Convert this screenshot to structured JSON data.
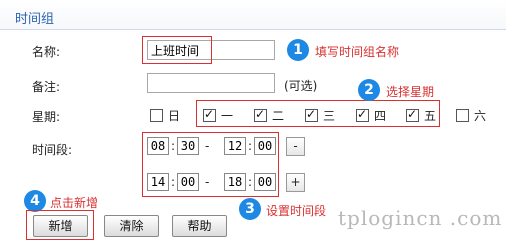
{
  "section_title": "时间组",
  "fields": {
    "name_label": "名称:",
    "name_value": "上班时间",
    "note_label": "备注:",
    "note_value": "",
    "note_hint": "(可选)",
    "week_label": "星期:",
    "time_label": "时间段:"
  },
  "weekdays": [
    {
      "label": "日",
      "checked": false
    },
    {
      "label": "一",
      "checked": true
    },
    {
      "label": "二",
      "checked": true
    },
    {
      "label": "三",
      "checked": true
    },
    {
      "label": "四",
      "checked": true
    },
    {
      "label": "五",
      "checked": true
    },
    {
      "label": "六",
      "checked": false
    }
  ],
  "time_ranges": [
    {
      "start_h": "08",
      "start_m": "30",
      "end_h": "12",
      "end_m": "00",
      "action": "-"
    },
    {
      "start_h": "14",
      "start_m": "00",
      "end_h": "18",
      "end_m": "00",
      "action": "+"
    }
  ],
  "time_sep": ":",
  "range_sep": "-",
  "buttons": {
    "add": "新增",
    "clear": "清除",
    "help": "帮助"
  },
  "annotations": [
    {
      "num": "1",
      "text": "填写时间组名称"
    },
    {
      "num": "2",
      "text": "选择星期"
    },
    {
      "num": "3",
      "text": "设置时间段"
    },
    {
      "num": "4",
      "text": "点击新增"
    }
  ],
  "watermark": "tplogincn .com",
  "colors": {
    "title": "#2d63b4",
    "annotation_red": "#d93030",
    "annotation_badge": "#1e88e5"
  }
}
